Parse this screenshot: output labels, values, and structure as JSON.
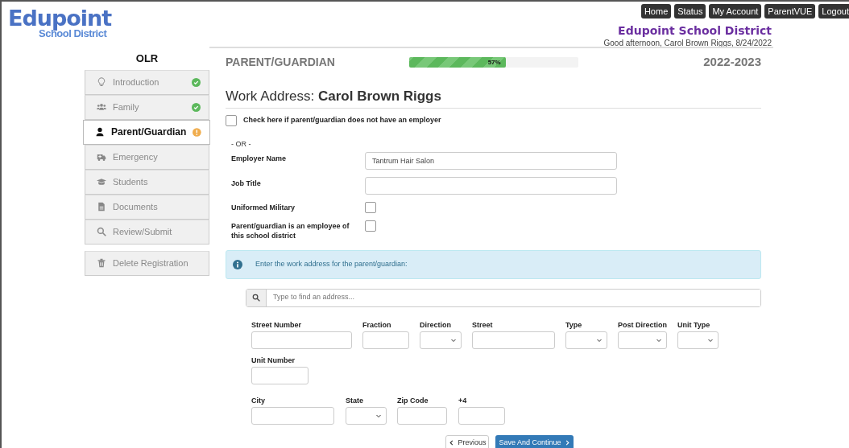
{
  "logo": {
    "name": "Edupoint",
    "subtitle": "School District"
  },
  "top_nav": [
    "Home",
    "Status",
    "My Account",
    "ParentVUE",
    "Logout"
  ],
  "district": "Edupoint School District",
  "greeting": "Good afternoon, Carol Brown Riggs, 8/24/2022",
  "sidebar": {
    "title": "OLR",
    "items": [
      {
        "label": "Introduction",
        "complete": true,
        "needs_attention": false,
        "selected": false
      },
      {
        "label": "Family",
        "complete": true,
        "needs_attention": false,
        "selected": false
      },
      {
        "label": "Parent/Guardian",
        "complete": false,
        "needs_attention": true,
        "selected": true
      },
      {
        "label": "Emergency",
        "complete": false,
        "needs_attention": false,
        "selected": false
      },
      {
        "label": "Students",
        "complete": false,
        "needs_attention": false,
        "selected": false
      },
      {
        "label": "Documents",
        "complete": false,
        "needs_attention": false,
        "selected": false
      },
      {
        "label": "Review/Submit",
        "complete": false,
        "needs_attention": false,
        "selected": false
      }
    ],
    "delete_button": "Delete Registration"
  },
  "section": {
    "title": "PARENT/GUARDIAN",
    "progress": {
      "level": 0.57,
      "reading": "57%"
    },
    "year": "2022-2023"
  },
  "form": {
    "heading": "Work Address:",
    "person": "Carol Brown Riggs",
    "no_employer": {
      "label": "Check here if parent/guardian does not have an employer",
      "checked": false
    },
    "or_text": "- OR -",
    "fields": [
      {
        "label": "Employer Name",
        "kind": "text",
        "value": "Tantrum Hair Salon"
      },
      {
        "label": "Job Title",
        "kind": "text"
      },
      {
        "label": "Uniformed Military",
        "kind": "checkbox",
        "checked": false
      },
      {
        "label": "Parent/guardian is an employee of this school district",
        "kind": "checkbox",
        "checked": false
      }
    ],
    "alert": "Enter the work address for the parent/guardian:",
    "search": {
      "placeholder": "Type to find an address..."
    },
    "address_rows": [
      [
        {
          "label": "Street Number",
          "kind": "text"
        },
        {
          "label": "Fraction",
          "kind": "text"
        },
        {
          "label": "Direction",
          "kind": "select"
        },
        {
          "label": "Street",
          "kind": "text"
        },
        {
          "label": "Type",
          "kind": "select"
        },
        {
          "label": "Post Direction",
          "kind": "select"
        },
        {
          "label": "Unit Type",
          "kind": "select"
        }
      ],
      [
        {
          "label": "Unit Number",
          "kind": "text"
        }
      ],
      [
        {
          "label": "City",
          "kind": "text"
        },
        {
          "label": "State",
          "kind": "select"
        },
        {
          "label": "Zip Code",
          "kind": "text"
        },
        {
          "label": "+4",
          "kind": "text"
        }
      ]
    ],
    "buttons": [
      {
        "label": "Previous",
        "kind": "back"
      },
      {
        "label": "Save And Continue",
        "kind": "next"
      }
    ]
  }
}
